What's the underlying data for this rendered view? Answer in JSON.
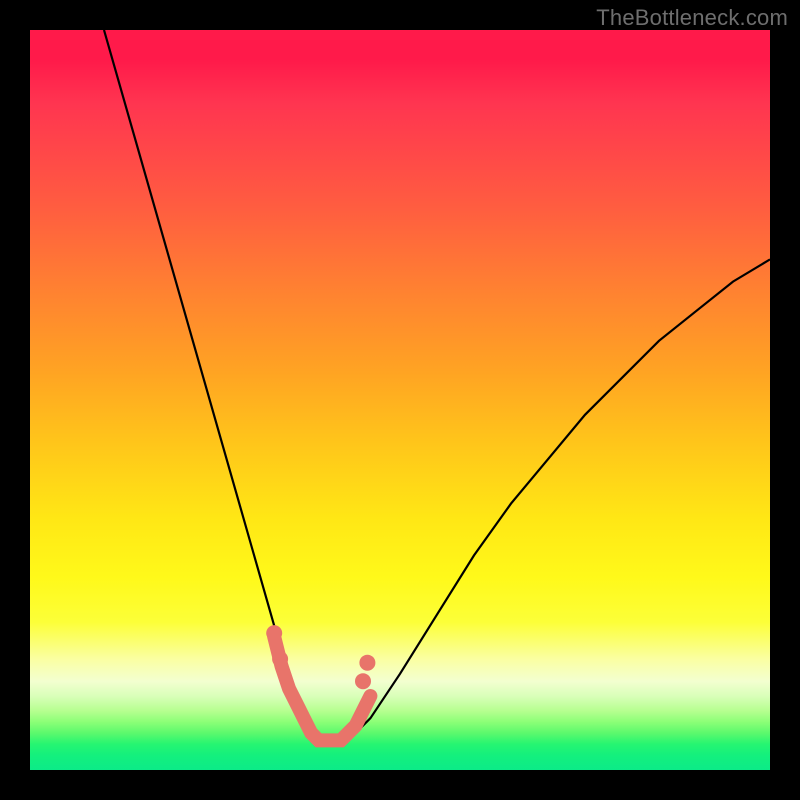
{
  "watermark": "TheBottleneck.com",
  "chart_data": {
    "type": "line",
    "title": "",
    "xlabel": "",
    "ylabel": "",
    "xlim": [
      0,
      100
    ],
    "ylim": [
      0,
      100
    ],
    "grid": false,
    "legend": false,
    "series": [
      {
        "name": "curve",
        "x": [
          10,
          14,
          18,
          22,
          26,
          30,
          32,
          34,
          36,
          37,
          38,
          39,
          40,
          42,
          44,
          46,
          50,
          55,
          60,
          65,
          70,
          75,
          80,
          85,
          90,
          95,
          100
        ],
        "y": [
          100,
          86,
          72,
          58,
          44,
          30,
          23,
          16,
          10,
          7,
          5,
          4,
          4,
          4,
          5,
          7,
          13,
          21,
          29,
          36,
          42,
          48,
          53,
          58,
          62,
          66,
          69
        ]
      }
    ],
    "highlight_segment": {
      "x": [
        33,
        34,
        35,
        36,
        37,
        38,
        39,
        40,
        41,
        42,
        43,
        44,
        45,
        46
      ],
      "y": [
        18,
        14,
        11,
        9,
        7,
        5,
        4,
        4,
        4,
        4,
        5,
        6,
        8,
        10
      ],
      "points": [
        {
          "x": 33.0,
          "y": 18.5
        },
        {
          "x": 33.8,
          "y": 15.0
        },
        {
          "x": 45.0,
          "y": 12.0
        },
        {
          "x": 45.6,
          "y": 14.5
        }
      ]
    },
    "background_gradient": {
      "orientation": "vertical",
      "stops": [
        {
          "pos": 0.0,
          "color": "#ff1a4a"
        },
        {
          "pos": 0.5,
          "color": "#ffc61a"
        },
        {
          "pos": 0.8,
          "color": "#fcff38"
        },
        {
          "pos": 1.0,
          "color": "#0ceb88"
        }
      ]
    }
  }
}
